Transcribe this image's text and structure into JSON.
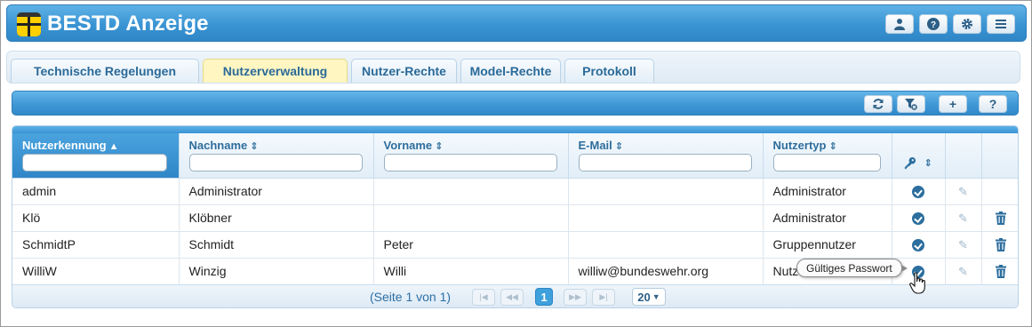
{
  "app": {
    "title": "BESTD Anzeige"
  },
  "header_buttons": [
    "user-icon",
    "help-icon",
    "gear-icon",
    "menu-icon"
  ],
  "tabs": [
    {
      "label": "Technische Regelungen",
      "active": false
    },
    {
      "label": "Nutzerverwaltung",
      "active": true
    },
    {
      "label": "Nutzer-Rechte",
      "active": false
    },
    {
      "label": "Model-Rechte",
      "active": false
    },
    {
      "label": "Protokoll",
      "active": false
    }
  ],
  "toolbar": {
    "buttons": [
      "refresh-icon",
      "filter-clear-icon",
      "add-icon",
      "help-icon"
    ],
    "add_label": "+",
    "help_label": "?"
  },
  "columns": [
    {
      "label": "Nutzerkennung",
      "sort": "asc",
      "filter_value": ""
    },
    {
      "label": "Nachname",
      "sort": "none",
      "filter_value": ""
    },
    {
      "label": "Vorname",
      "sort": "none",
      "filter_value": ""
    },
    {
      "label": "E-Mail",
      "sort": "none",
      "filter_value": ""
    },
    {
      "label": "Nutzertyp",
      "sort": "none",
      "filter_value": ""
    }
  ],
  "rows": [
    {
      "kennung": "admin",
      "nachname": "Administrator",
      "vorname": "",
      "email": "",
      "typ": "Administrator",
      "password_valid": true,
      "deletable": false
    },
    {
      "kennung": "Klö",
      "nachname": "Klöbner",
      "vorname": "",
      "email": "",
      "typ": "Administrator",
      "password_valid": true,
      "deletable": true
    },
    {
      "kennung": "SchmidtP",
      "nachname": "Schmidt",
      "vorname": "Peter",
      "email": "",
      "typ": "Gruppennutzer",
      "password_valid": true,
      "deletable": true
    },
    {
      "kennung": "WilliW",
      "nachname": "Winzig",
      "vorname": "Willi",
      "email": "williw@bundeswehr.org",
      "typ": "Nutzer",
      "password_valid": true,
      "deletable": true
    }
  ],
  "pager": {
    "info": "(Seite 1 von 1)",
    "current_page": "1",
    "page_size": "20"
  },
  "tooltip": {
    "text": "Gültiges Passwort"
  },
  "colors": {
    "header_blue": "#3a94d3",
    "tab_active": "#fff6c2",
    "accent_text": "#2e6d9c"
  }
}
